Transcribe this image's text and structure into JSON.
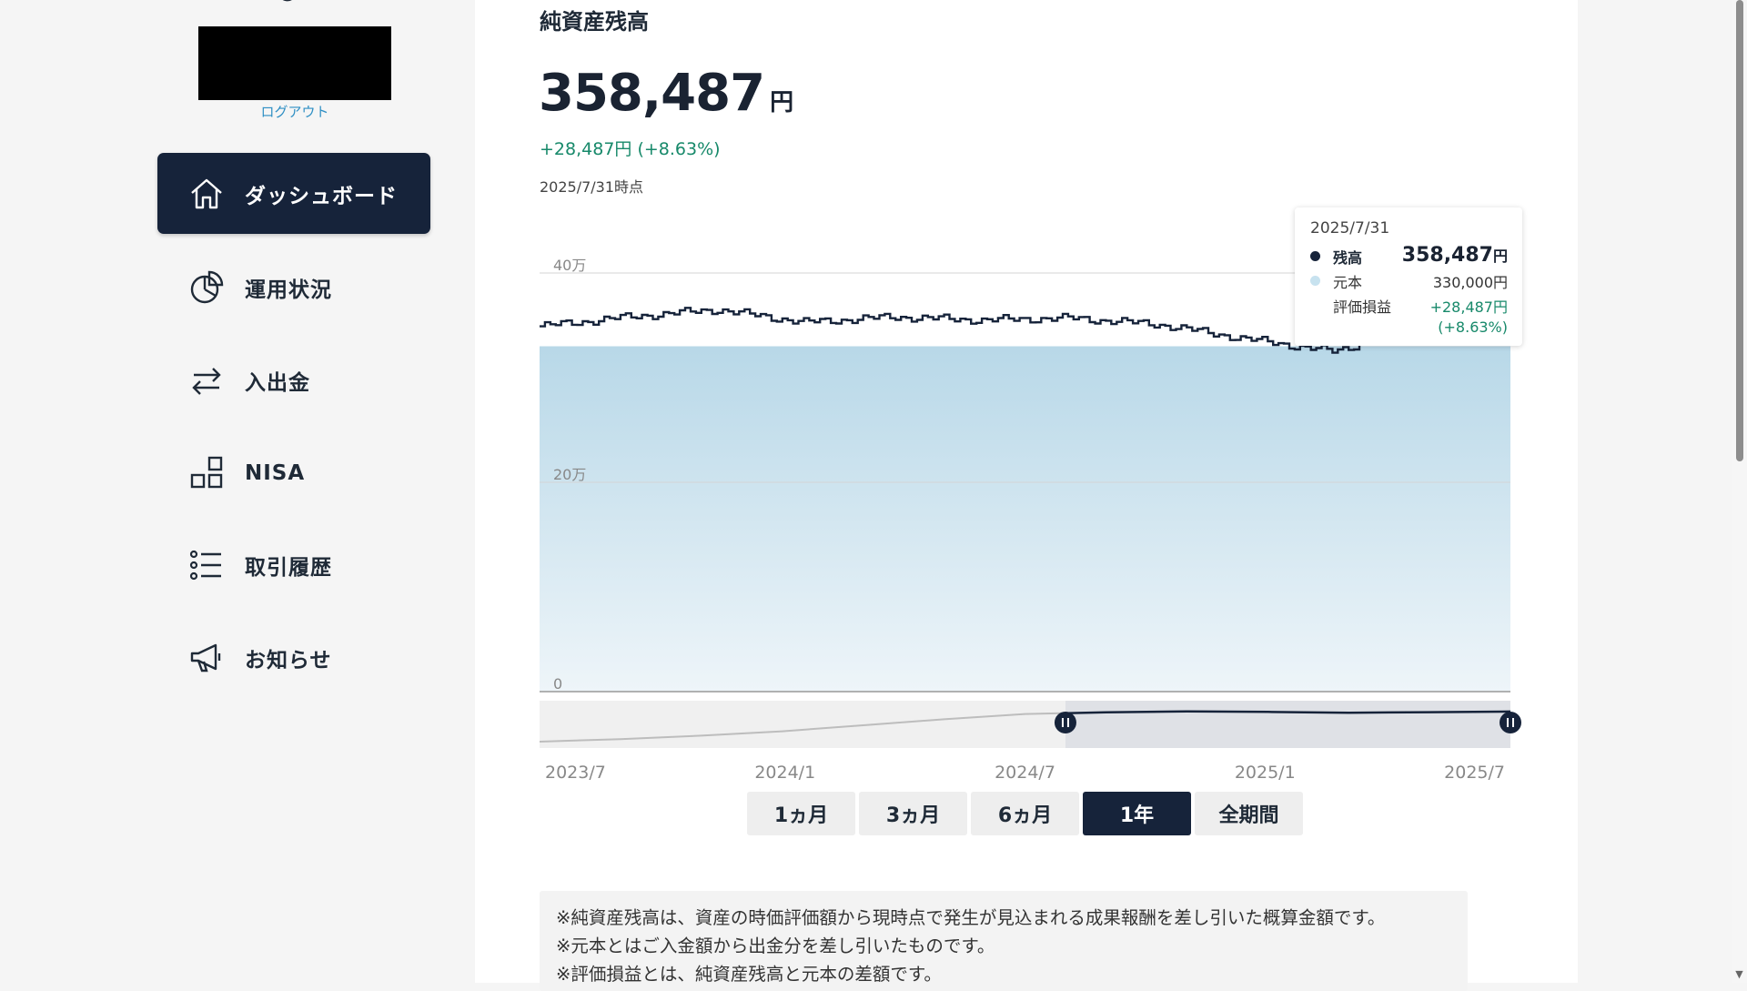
{
  "sidebar": {
    "logout_label": "ログアウト",
    "items": [
      {
        "label": "ダッシュボード",
        "icon": "home-icon",
        "active": true
      },
      {
        "label": "運用状況",
        "icon": "pie-chart-icon",
        "active": false
      },
      {
        "label": "入出金",
        "icon": "transfer-arrows-icon",
        "active": false
      },
      {
        "label": "NISA",
        "icon": "blocks-icon",
        "active": false
      },
      {
        "label": "取引履歴",
        "icon": "list-icon",
        "active": false
      },
      {
        "label": "お知らせ",
        "icon": "megaphone-icon",
        "active": false
      }
    ]
  },
  "main": {
    "title": "純資産残高",
    "balance_value": "358,487",
    "balance_unit": "円",
    "change_text": "+28,487円 (+8.63%)",
    "as_of": "2025/7/31時点"
  },
  "tooltip": {
    "date": "2025/7/31",
    "balance_label": "残高",
    "balance_value": "358,487",
    "balance_unit": "円",
    "principal_label": "元本",
    "principal_value": "330,000円",
    "pl_label": "評価損益",
    "pl_value": "+28,487円",
    "pl_percent": "(+8.63%)"
  },
  "range_buttons": [
    {
      "label": "1ヵ月",
      "active": false
    },
    {
      "label": "3ヵ月",
      "active": false
    },
    {
      "label": "6ヵ月",
      "active": false
    },
    {
      "label": "1年",
      "active": true
    },
    {
      "label": "全期間",
      "active": false
    }
  ],
  "notes": [
    "※純資産残高は、資産の時価評価額から現時点で発生が見込まれる成果報酬を差し引いた概算金額です。",
    "※元本とはご入金額から出金分を差し引いたものです。",
    "※評価損益とは、純資産残高と元本の差額です。"
  ],
  "colors": {
    "navy": "#16233a",
    "positive": "#17896a",
    "link": "#2f8fc4",
    "area_top": "#b8d8e8",
    "area_bottom": "#eef5f9"
  },
  "chart_data": {
    "type": "line",
    "y_tick_labels": [
      "40万",
      "20万",
      "0"
    ],
    "y_ticks": [
      400000,
      200000,
      0
    ],
    "ylim": [
      0,
      400000
    ],
    "x_tick_labels": [
      "2023/7",
      "2024/1",
      "2024/7",
      "2025/1",
      "2025/7"
    ],
    "grid": true,
    "series": [
      {
        "name": "残高",
        "x": [
          "2024/8",
          "2024/9",
          "2024/10",
          "2024/11",
          "2024/12",
          "2025/1",
          "2025/2",
          "2025/3",
          "2025/4",
          "2025/5",
          "2025/6",
          "2025/7"
        ],
        "values": [
          349000,
          358000,
          365000,
          353000,
          358000,
          355000,
          357000,
          351000,
          337000,
          325000,
          350000,
          358487
        ]
      },
      {
        "name": "元本",
        "x": [
          "2024/8",
          "2025/7"
        ],
        "values": [
          330000,
          330000
        ]
      }
    ],
    "navigator": {
      "x": [
        "2023/7",
        "2023/9",
        "2023/11",
        "2024/1",
        "2024/3",
        "2024/5",
        "2024/7",
        "2024/9",
        "2024/11",
        "2025/1",
        "2025/3",
        "2025/5",
        "2025/7"
      ],
      "values": [
        10000,
        40000,
        80000,
        130000,
        200000,
        270000,
        330000,
        350000,
        360000,
        355000,
        345000,
        352000,
        358487
      ],
      "selected_range": [
        "2024/8",
        "2025/7"
      ]
    }
  }
}
